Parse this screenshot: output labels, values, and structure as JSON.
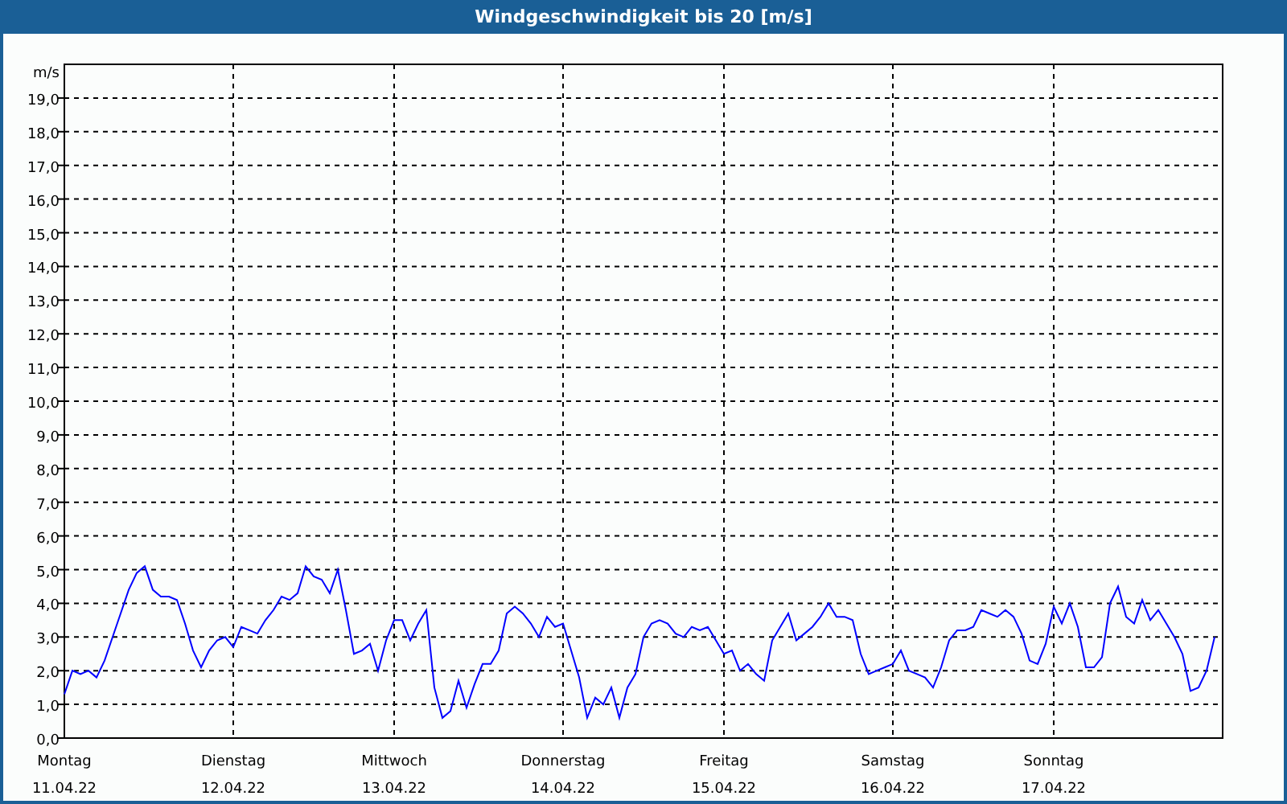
{
  "window": {
    "title": "Windgeschwindigkeit bis 20 [m/s]"
  },
  "chart": {
    "chart_data": {
      "type": "line",
      "ylabel": "m/s",
      "grid": true,
      "ylim": [
        0,
        20
      ],
      "categories": [
        "Montag",
        null,
        null,
        null,
        null,
        null,
        null,
        null,
        null,
        null,
        null,
        null,
        null,
        null,
        null,
        null,
        null,
        null,
        null,
        null,
        null,
        "Dienstag",
        null,
        null,
        null,
        null,
        null,
        null,
        null,
        null,
        null,
        null,
        null,
        null,
        null,
        null,
        null,
        null,
        null,
        null,
        null,
        "Mittwoch",
        null,
        null,
        null,
        null,
        null,
        null,
        null,
        null,
        null,
        null,
        null,
        null,
        null,
        null,
        null,
        null,
        null,
        null,
        null,
        null,
        "Donnerstag",
        null,
        null,
        null,
        null,
        null,
        null,
        null,
        null,
        null,
        null,
        null,
        null,
        null,
        null,
        null,
        null,
        null,
        null,
        null,
        "Freitag",
        null,
        null,
        null,
        null,
        null,
        null,
        null,
        null,
        null,
        null,
        null,
        null,
        null,
        null,
        null,
        null,
        null,
        null,
        null,
        null,
        "Samstag",
        null,
        null,
        null,
        null,
        null,
        null,
        null,
        null,
        null,
        null,
        null,
        null,
        null,
        null,
        null,
        null,
        null,
        null,
        null,
        "Sonntag",
        null,
        null,
        null,
        null,
        null,
        null,
        null,
        null,
        null,
        null,
        null,
        null,
        null,
        null,
        null,
        null,
        null,
        null,
        null,
        null
      ],
      "yticks": [
        {
          "value": 0,
          "label": "0,0"
        },
        {
          "value": 1,
          "label": "1,0"
        },
        {
          "value": 2,
          "label": "2,0"
        },
        {
          "value": 3,
          "label": "3,0"
        },
        {
          "value": 4,
          "label": "4,0"
        },
        {
          "value": 5,
          "label": "5,0"
        },
        {
          "value": 6,
          "label": "6,0"
        },
        {
          "value": 7,
          "label": "7,0"
        },
        {
          "value": 8,
          "label": "8,0"
        },
        {
          "value": 9,
          "label": "9,0"
        },
        {
          "value": 10,
          "label": "10,0"
        },
        {
          "value": 11,
          "label": "11,0"
        },
        {
          "value": 12,
          "label": "12,0"
        },
        {
          "value": 13,
          "label": "13,0"
        },
        {
          "value": 14,
          "label": "14,0"
        },
        {
          "value": 15,
          "label": "15,0"
        },
        {
          "value": 16,
          "label": "16,0"
        },
        {
          "value": 17,
          "label": "17,0"
        },
        {
          "value": 18,
          "label": "18,0"
        },
        {
          "value": 19,
          "label": "19,0"
        }
      ],
      "series": [
        {
          "color": "#0000ff",
          "values": [
            1.3,
            2.0,
            1.9,
            2.0,
            1.8,
            2.3,
            3.0,
            3.7,
            4.4,
            4.9,
            5.1,
            4.4,
            4.2,
            4.2,
            4.1,
            3.4,
            2.6,
            2.1,
            2.6,
            2.9,
            3.0,
            2.7,
            3.3,
            3.2,
            3.1,
            3.5,
            3.8,
            4.2,
            4.1,
            4.3,
            5.1,
            4.8,
            4.7,
            4.3,
            5.0,
            3.8,
            2.5,
            2.6,
            2.8,
            2.0,
            2.9,
            3.5,
            3.5,
            2.9,
            3.4,
            3.8,
            1.5,
            0.6,
            0.8,
            1.7,
            0.9,
            1.6,
            2.2,
            2.2,
            2.6,
            3.7,
            3.9,
            3.7,
            3.4,
            3.0,
            3.6,
            3.3,
            3.4,
            2.6,
            1.8,
            0.6,
            1.2,
            1.0,
            1.5,
            0.6,
            1.5,
            1.9,
            3.0,
            3.4,
            3.5,
            3.4,
            3.1,
            3.0,
            3.3,
            3.2,
            3.3,
            2.9,
            2.5,
            2.6,
            2.0,
            2.2,
            1.9,
            1.7,
            2.9,
            3.3,
            3.7,
            2.9,
            3.1,
            3.3,
            3.6,
            4.0,
            3.6,
            3.6,
            3.5,
            2.5,
            1.9,
            2.0,
            2.1,
            2.2,
            2.6,
            2.0,
            1.9,
            1.8,
            1.5,
            2.1,
            2.9,
            3.2,
            3.2,
            3.3,
            3.8,
            3.7,
            3.6,
            3.8,
            3.6,
            3.1,
            2.3,
            2.2,
            2.8,
            3.9,
            3.4,
            4.0,
            3.3,
            2.1,
            2.1,
            2.4,
            4.0,
            4.5,
            3.6,
            3.4,
            4.1,
            3.5,
            3.8,
            3.4,
            3.0,
            2.5,
            1.4,
            1.5,
            2.0,
            3.0
          ]
        }
      ]
    },
    "x_dates": [
      "11.04.22",
      "12.04.22",
      "13.04.22",
      "14.04.22",
      "15.04.22",
      "16.04.22",
      "17.04.22"
    ]
  }
}
